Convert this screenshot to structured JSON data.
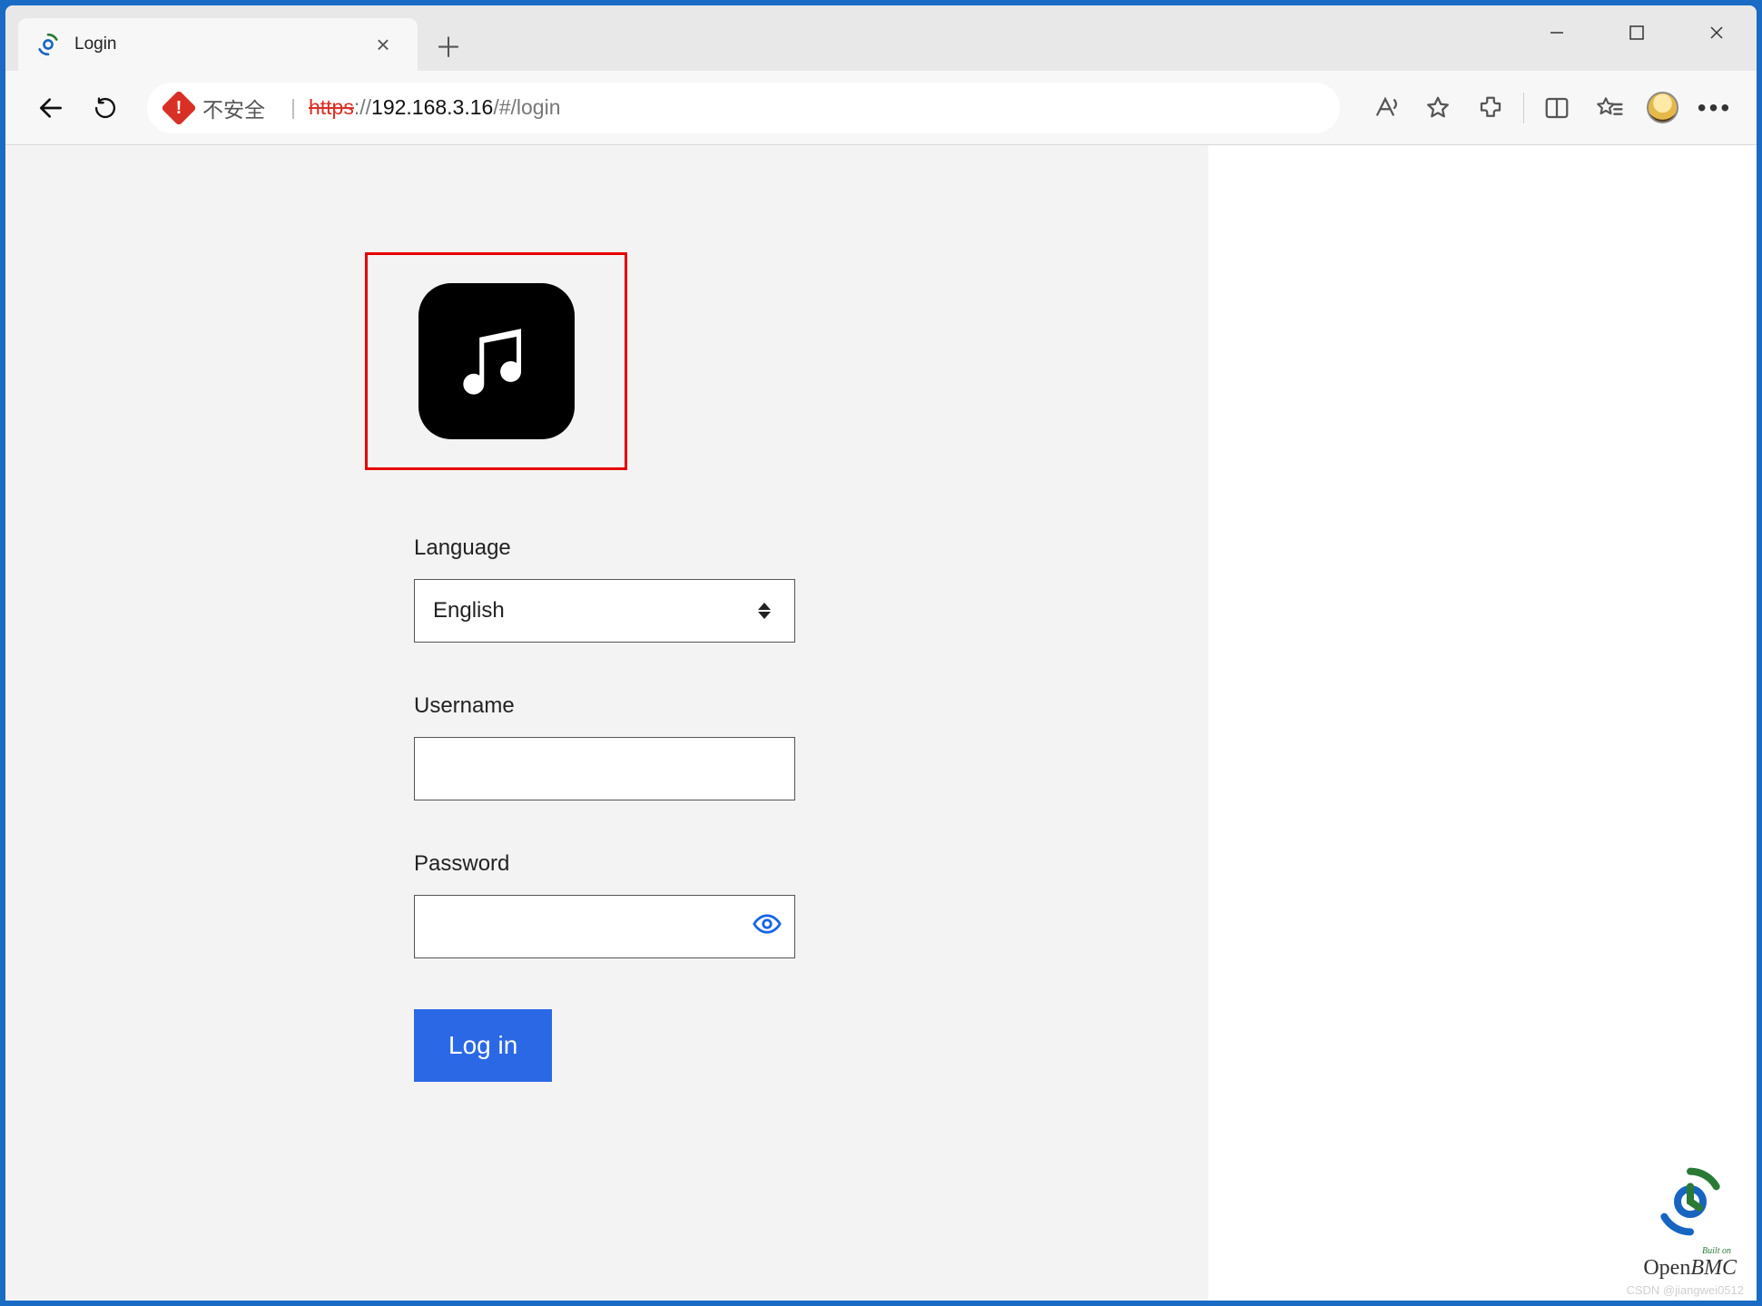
{
  "browser": {
    "tab": {
      "title": "Login"
    },
    "address": {
      "security_label": "不安全",
      "url_prefix": "https",
      "url_sep": "://",
      "url_host": "192.168.3.16",
      "url_path": "/#/login"
    }
  },
  "form": {
    "language_label": "Language",
    "language_value": "English",
    "username_label": "Username",
    "username_value": "",
    "password_label": "Password",
    "password_value": "",
    "login_label": "Log in"
  },
  "footer": {
    "built_on": "Built on",
    "open": "Open",
    "bmc": "BMC",
    "watermark": "CSDN @jiangwei0512"
  }
}
